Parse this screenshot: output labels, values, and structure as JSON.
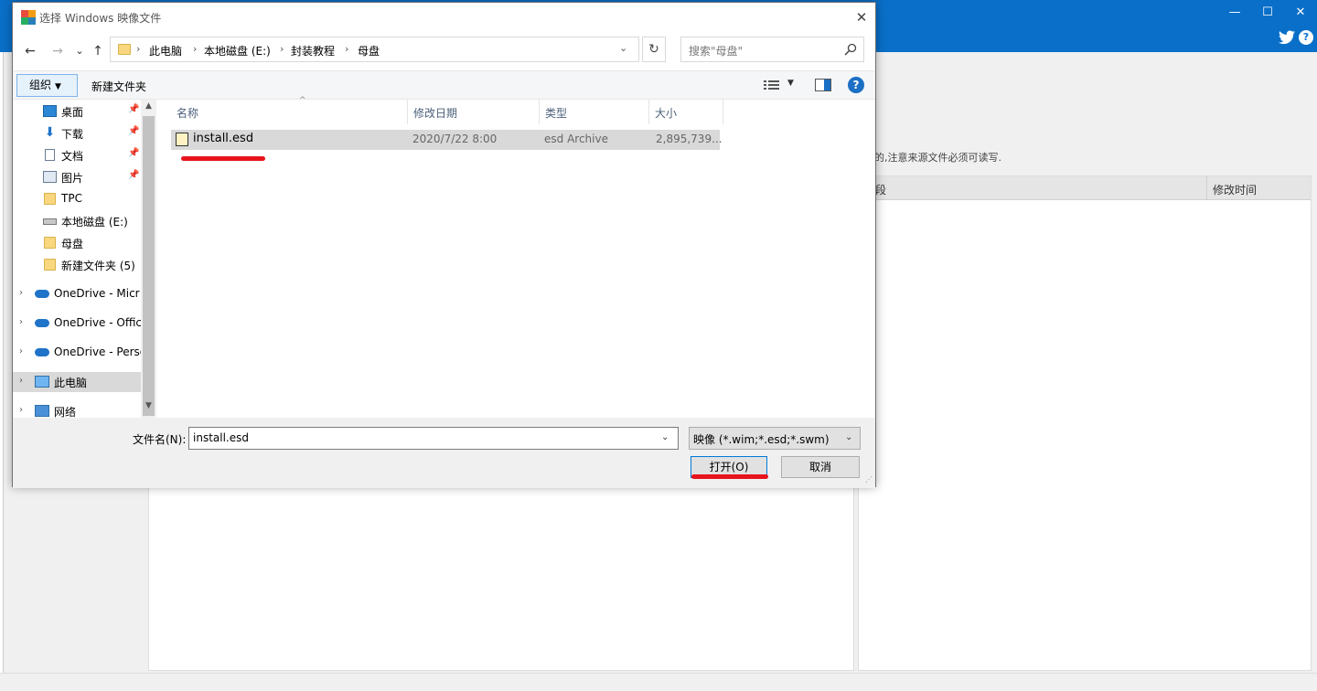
{
  "background": {
    "note": "的,注意来源文件必须可读写.",
    "table_col1": "段",
    "table_col2": "修改时间",
    "win_min": "—",
    "win_max": "☐",
    "win_close": "✕",
    "help": "?"
  },
  "dialog": {
    "title": "选择 Windows 映像文件",
    "close": "✕",
    "nav": {
      "back": "←",
      "forward": "→",
      "recent": "⌄",
      "up": "↑"
    },
    "address": {
      "crumbs": [
        "此电脑",
        "本地磁盘 (E:)",
        "封装教程",
        "母盘"
      ],
      "separator": "›",
      "dropdown": "⌄",
      "refresh": "↻"
    },
    "search": {
      "placeholder": "搜索\"母盘\""
    },
    "toolbar": {
      "organize": "组织",
      "organize_caret": "▼",
      "new_folder": "新建文件夹",
      "view_caret": "▼",
      "help": "?"
    },
    "nav_pane": {
      "items": [
        {
          "label": "桌面",
          "icon": "desktop-icon",
          "pinned": true
        },
        {
          "label": "下载",
          "icon": "download-icon",
          "pinned": true
        },
        {
          "label": "文档",
          "icon": "document-icon",
          "pinned": true
        },
        {
          "label": "图片",
          "icon": "pictures-icon",
          "pinned": true
        },
        {
          "label": "TPC",
          "icon": "folder-icon",
          "pinned": false
        },
        {
          "label": "本地磁盘 (E:)",
          "icon": "drive-icon",
          "pinned": false
        },
        {
          "label": "母盘",
          "icon": "folder-icon",
          "pinned": false
        },
        {
          "label": "新建文件夹 (5)",
          "icon": "folder-icon",
          "pinned": false
        },
        {
          "label": "OneDrive - Micr",
          "icon": "onedrive-icon",
          "expandable": true
        },
        {
          "label": "OneDrive - Offic",
          "icon": "onedrive-icon",
          "expandable": true
        },
        {
          "label": "OneDrive - Perso",
          "icon": "onedrive-icon",
          "expandable": true
        },
        {
          "label": "此电脑",
          "icon": "computer-icon",
          "expandable": true,
          "selected": true
        },
        {
          "label": "网络",
          "icon": "network-icon",
          "expandable": true
        }
      ],
      "pin_glyph": "📌",
      "expander_glyph": "›",
      "scroll_up": "▲",
      "scroll_down": "▼"
    },
    "columns": {
      "name": "名称",
      "date": "修改日期",
      "type": "类型",
      "size": "大小",
      "sort_arrow": "^"
    },
    "files": [
      {
        "name": "install.esd",
        "date": "2020/7/22 8:00",
        "type": "esd Archive",
        "size": "2,895,739..."
      }
    ],
    "bottom": {
      "filename_label": "文件名(N):",
      "filename_value": "install.esd",
      "dropdown": "⌄",
      "filter_value": "映像 (*.wim;*.esd;*.swm)",
      "open": "打开(O)",
      "cancel": "取消",
      "grip": "⋰"
    }
  },
  "colors": {
    "titlebar_blue": "#0a6fc8",
    "annotation_red": "#e8141b",
    "selection_gray": "#d9d9d9"
  }
}
